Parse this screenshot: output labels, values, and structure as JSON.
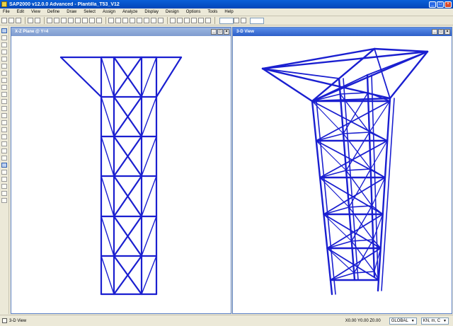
{
  "app": {
    "title": "SAP2000 v12.0.0 Advanced  - Plantilla_T53_V12"
  },
  "menus": [
    "File",
    "Edit",
    "View",
    "Define",
    "Draw",
    "Select",
    "Assign",
    "Analyze",
    "Display",
    "Design",
    "Options",
    "Tools",
    "Help"
  ],
  "panels": {
    "left": {
      "title": "X-Z Plane @ Y=4"
    },
    "right": {
      "title": "3-D View"
    }
  },
  "status": {
    "view_label": "3-D View",
    "coordinates": "X0.00  Y0.00  Z0.00",
    "coord_system": "GLOBAL",
    "units": "KN, m, C"
  },
  "colors": {
    "member": "#1a1fd0",
    "titlebar": "#0a5fd8",
    "panel_active": "#2c5fc8"
  },
  "icons": {
    "app": "sap2000-app-icon",
    "minimize": "minimize-icon",
    "maximize": "maximize-icon",
    "close": "close-icon"
  }
}
